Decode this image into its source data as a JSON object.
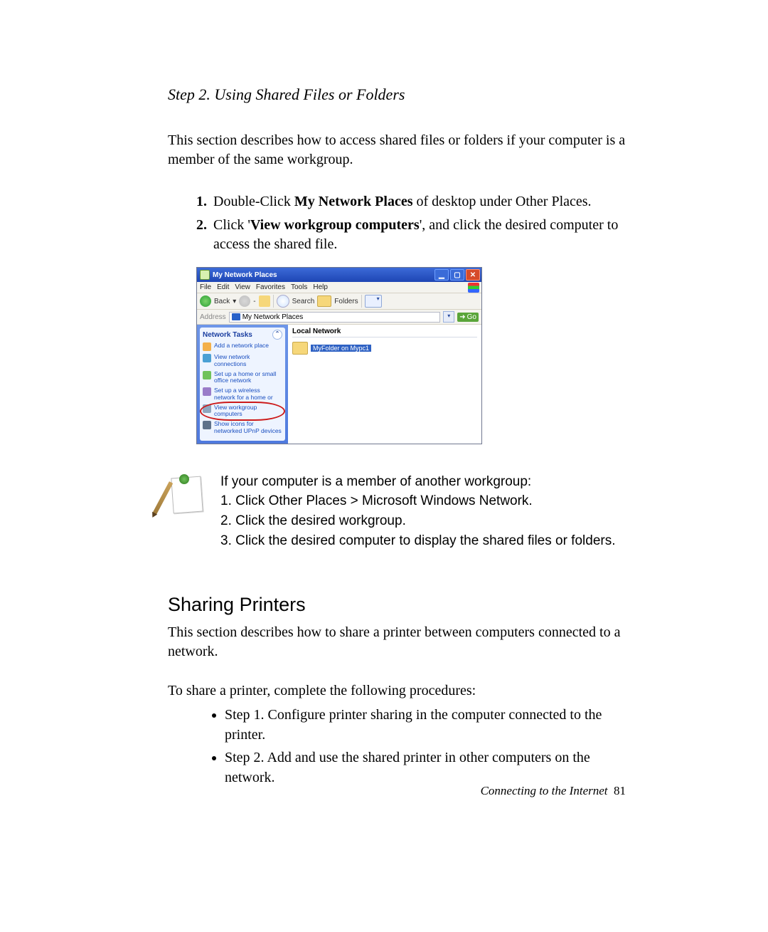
{
  "step_title": "Step 2. Using Shared Files or Folders",
  "intro": "This section describes how to access shared files or folders if your computer is a member of the same workgroup.",
  "list": {
    "item1_pre": "Double-Click ",
    "item1_bold": "My Network Places",
    "item1_post": " of desktop under Other Places.",
    "item2_pre": "Click '",
    "item2_bold": "View workgroup computers",
    "item2_post": "', and click the desired computer to access the shared file."
  },
  "xp": {
    "title": "My Network Places",
    "menu": {
      "file": "File",
      "edit": "Edit",
      "view": "View",
      "favorites": "Favorites",
      "tools": "Tools",
      "help": "Help"
    },
    "toolbar": {
      "back": "Back",
      "search": "Search",
      "folders": "Folders"
    },
    "address": {
      "label": "Address",
      "value": "My Network Places",
      "go": "Go"
    },
    "tasks_header": "Network Tasks",
    "tasks": {
      "add": "Add a network place",
      "view_conn": "View network connections",
      "home": "Set up a home or small office network",
      "wireless": "Set up a wireless network for a home or",
      "workgroup": "View workgroup computers",
      "upnp": "Show icons for networked UPnP devices"
    },
    "main": {
      "group": "Local Network",
      "item": "MyFolder on Mypc1"
    }
  },
  "note": {
    "line0": "If your computer is a member of another workgroup:",
    "line1": "1. Click Other Places > Microsoft Windows Network.",
    "line2": "2. Click the desired workgroup.",
    "line3": "3. Click the desired computer to display the shared files or folders."
  },
  "section2_title": "Sharing Printers",
  "section2_intro": "This section describes how to share a printer between computers connected to a network.",
  "procedures_intro": "To share a printer, complete the following procedures:",
  "bullets": {
    "b1": "Step 1. Configure printer sharing in the computer connected to the printer.",
    "b2": "Step 2. Add and use the shared printer in other computers on the network."
  },
  "footer_text": "Connecting to the Internet",
  "footer_page": "81"
}
